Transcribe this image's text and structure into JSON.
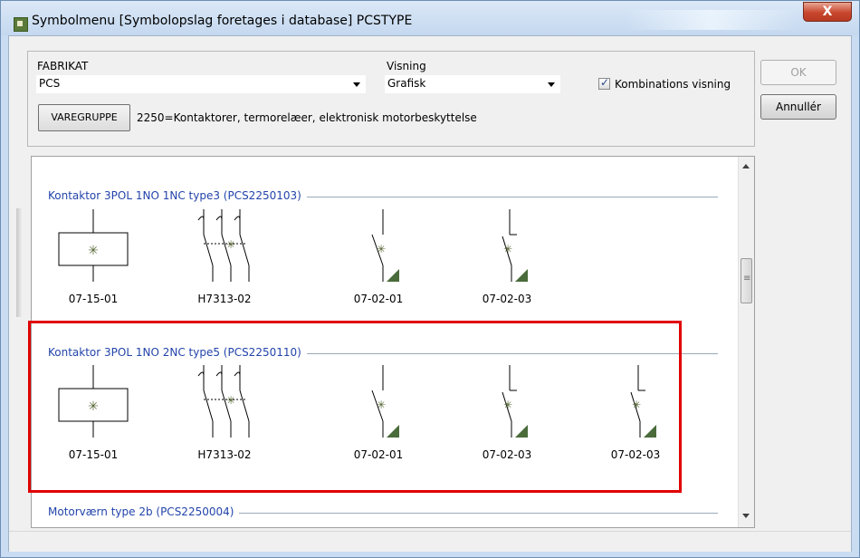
{
  "window": {
    "title": "Symbolmenu [Symbolopslag foretages i database]  PCSTYPE",
    "close_label": "X"
  },
  "form": {
    "fabrikat_label": "FABRIKAT",
    "fabrikat_value": "PCS",
    "visning_label": "Visning",
    "visning_value": "Grafisk",
    "kombination_label": "Kombinations visning",
    "kombination_checked": true,
    "varegruppe_button": "VAREGRUPPE",
    "varegruppe_text": "2250=Kontaktorer, termorelæer, elektronisk motorbeskyttelse"
  },
  "buttons": {
    "ok": "OK",
    "cancel": "Annullér"
  },
  "sections": [
    {
      "title": "Kontaktor 3POL 1NO 1NC type3 (PCS2250103)",
      "symbols": [
        {
          "label": "07-15-01",
          "icon": "coil-symbol"
        },
        {
          "label": "H7313-02",
          "icon": "three-pole-contact-symbol"
        },
        {
          "label": "07-02-01",
          "icon": "no-contact-symbol"
        },
        {
          "label": "07-02-03",
          "icon": "nc-contact-symbol"
        }
      ]
    },
    {
      "title": "Kontaktor 3POL 1NO 2NC type5 (PCS2250110)",
      "symbols": [
        {
          "label": "07-15-01",
          "icon": "coil-symbol"
        },
        {
          "label": "H7313-02",
          "icon": "three-pole-contact-symbol"
        },
        {
          "label": "07-02-01",
          "icon": "no-contact-symbol"
        },
        {
          "label": "07-02-03",
          "icon": "nc-contact-symbol"
        },
        {
          "label": "07-02-03",
          "icon": "nc-contact-symbol"
        }
      ]
    },
    {
      "title": "Motorværn type 2b (PCS2250004)",
      "symbols": []
    }
  ]
}
